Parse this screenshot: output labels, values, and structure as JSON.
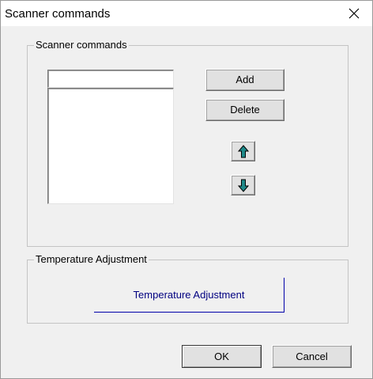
{
  "window": {
    "title": "Scanner commands",
    "close_icon": "close-icon"
  },
  "scanner_group": {
    "label": "Scanner commands",
    "command_input": {
      "value": "",
      "placeholder": ""
    },
    "command_list": {
      "items": []
    },
    "add_label": "Add",
    "delete_label": "Delete",
    "move_up_icon": "arrow-up-icon",
    "move_down_icon": "arrow-down-icon",
    "arrow_color": "#1f8a8a"
  },
  "temperature_group": {
    "label": "Temperature Adjustment",
    "button_label": "Temperature Adjustment",
    "button_text_color": "#000080"
  },
  "footer": {
    "ok_label": "OK",
    "cancel_label": "Cancel"
  }
}
